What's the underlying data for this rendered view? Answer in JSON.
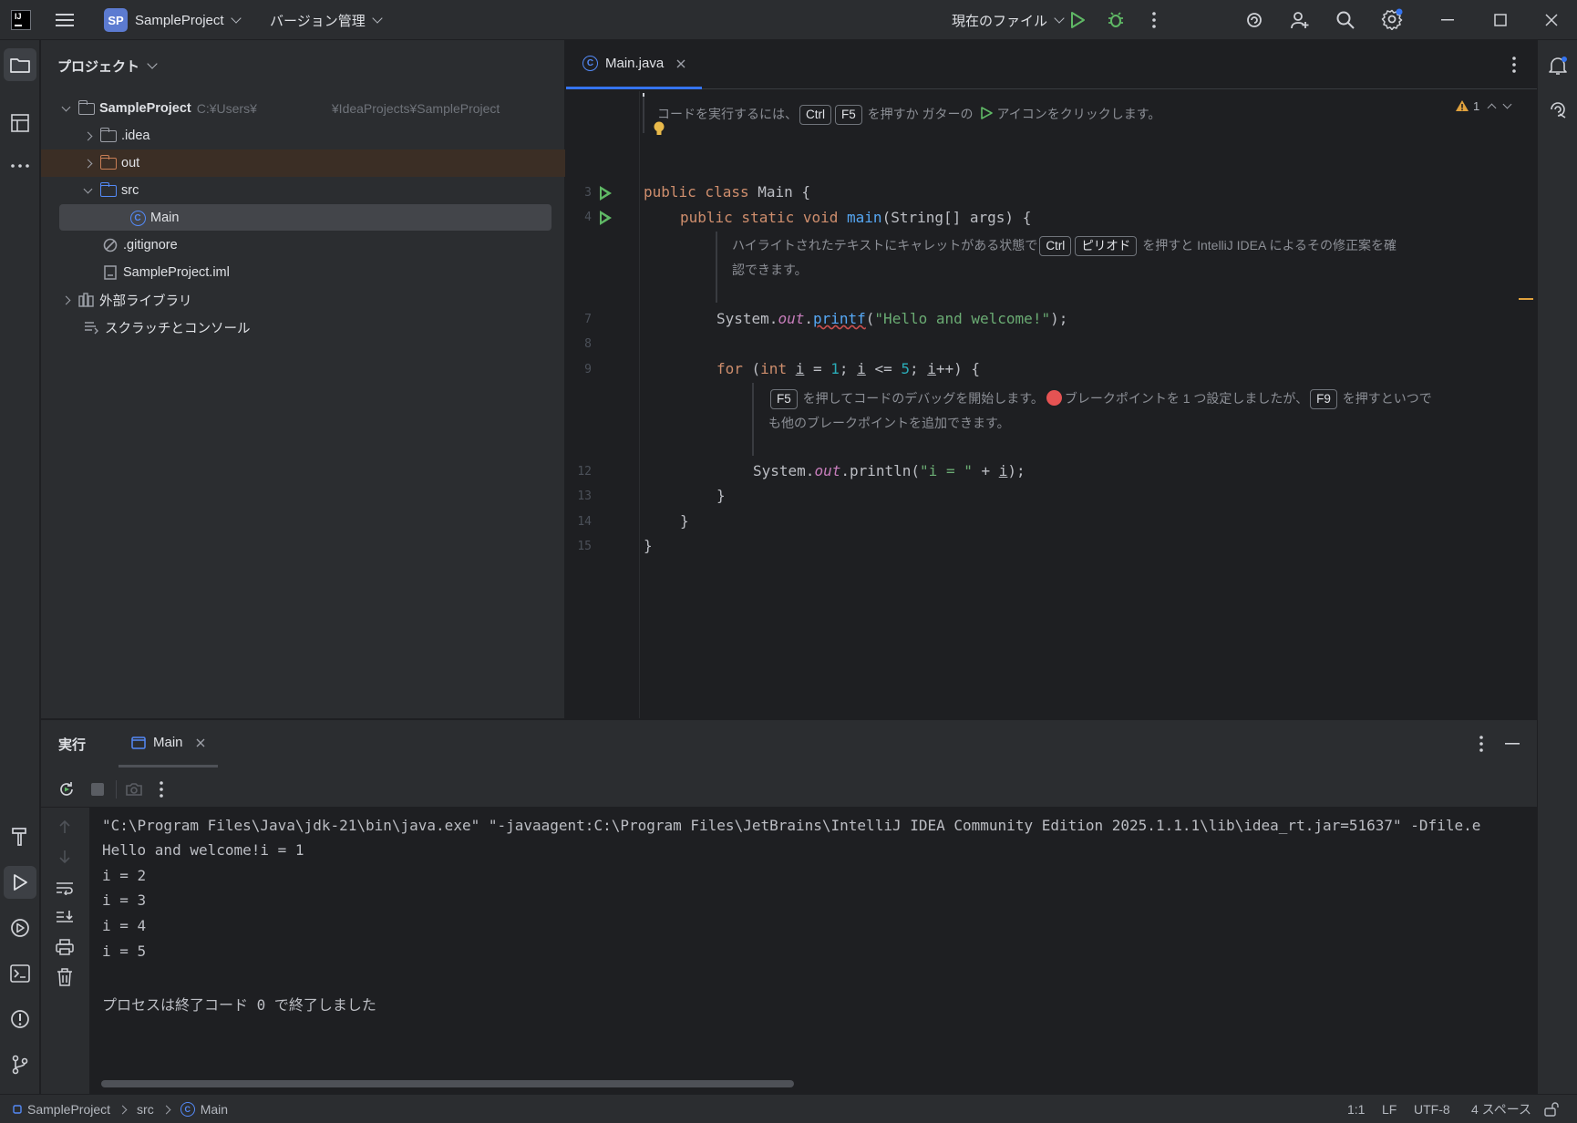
{
  "titlebar": {
    "logo": "IJ",
    "project_badge": "SP",
    "project_name": "SampleProject",
    "vcs_menu": "バージョン管理",
    "run_config": "現在のファイル"
  },
  "project_panel": {
    "title": "プロジェクト",
    "tree": [
      {
        "label": "SampleProject",
        "path": "C:¥Users¥",
        "path_tail": "¥IdeaProjects¥SampleProject"
      },
      {
        "label": ".idea"
      },
      {
        "label": "out"
      },
      {
        "label": "src"
      },
      {
        "label": "Main"
      },
      {
        "label": ".gitignore"
      },
      {
        "label": "SampleProject.iml"
      },
      {
        "label": "外部ライブラリ"
      },
      {
        "label": "スクラッチとコンソール"
      }
    ]
  },
  "editor": {
    "tab_label": "Main.java",
    "warning_count": "1",
    "hint1": {
      "pre": "コードを実行するには、",
      "k1": "Ctrl",
      "k2": "F5",
      "mid": "を押すか ガターの",
      "post": "アイコンをクリックします。"
    },
    "hint2": {
      "pre": "ハイライトされたテキストにキャレットがある状態で",
      "k1": "Ctrl",
      "k2": "ピリオド",
      "post": "を押すと IntelliJ IDEA によるその修正案を確",
      "line2": "認できます。"
    },
    "hint3": {
      "k1": "F5",
      "pre": "を押してコードのデバッグを開始します。",
      "mid": "ブレークポイントを 1 つ設定しましたが、",
      "k2": "F9",
      "post": "を押すといつで",
      "line2": "も他のブレークポイントを追加できます。"
    },
    "line_numbers": [
      "3",
      "4",
      "7",
      "8",
      "9",
      "12",
      "13",
      "14",
      "15"
    ],
    "code": {
      "l3_kw": "public class",
      "l3_rest": " Main {",
      "l4_kw": "public static void",
      "l4_fn": "main",
      "l4_rest": "(String[] args) {",
      "l7_a": "System.",
      "l7_out": "out",
      "l7_dot": ".",
      "l7_fn": "printf",
      "l7_p1": "(",
      "l7_str": "\"Hello and welcome!\"",
      "l7_p2": ");",
      "l9_kw": "for",
      "l9_a": " (",
      "l9_int": "int",
      "l9_i1": "i",
      "l9_b": " = ",
      "l9_n1": "1",
      "l9_c": "; ",
      "l9_i2": "i",
      "l9_d": " <= ",
      "l9_n5": "5",
      "l9_e": "; ",
      "l9_i3": "i",
      "l9_f": "++) {",
      "l12_a": "System.",
      "l12_out": "out",
      "l12_b": ".println(",
      "l12_str": "\"i = \"",
      "l12_c": " + ",
      "l12_i": "i",
      "l12_d": ");",
      "l13": "}",
      "l14": "}",
      "l15": "}"
    }
  },
  "run_panel": {
    "title": "実行",
    "tab_label": "Main",
    "console": [
      "\"C:\\Program Files\\Java\\jdk-21\\bin\\java.exe\" \"-javaagent:C:\\Program Files\\JetBrains\\IntelliJ IDEA Community Edition 2025.1.1.1\\lib\\idea_rt.jar=51637\" -Dfile.e",
      "Hello and welcome!i = 1",
      "i = 2",
      "i = 3",
      "i = 4",
      "i = 5",
      "",
      "プロセスは終了コード 0 で終了しました"
    ]
  },
  "statusbar": {
    "crumb1": "SampleProject",
    "crumb2": "src",
    "crumb3": "Main",
    "position": "1:1",
    "line_sep": "LF",
    "encoding": "UTF-8",
    "indent": "4 スペース"
  },
  "colors": {
    "accent": "#3574f0",
    "run_green": "#5fb865",
    "breakpoint_red": "#e55353",
    "warning": "#e0a13d"
  }
}
